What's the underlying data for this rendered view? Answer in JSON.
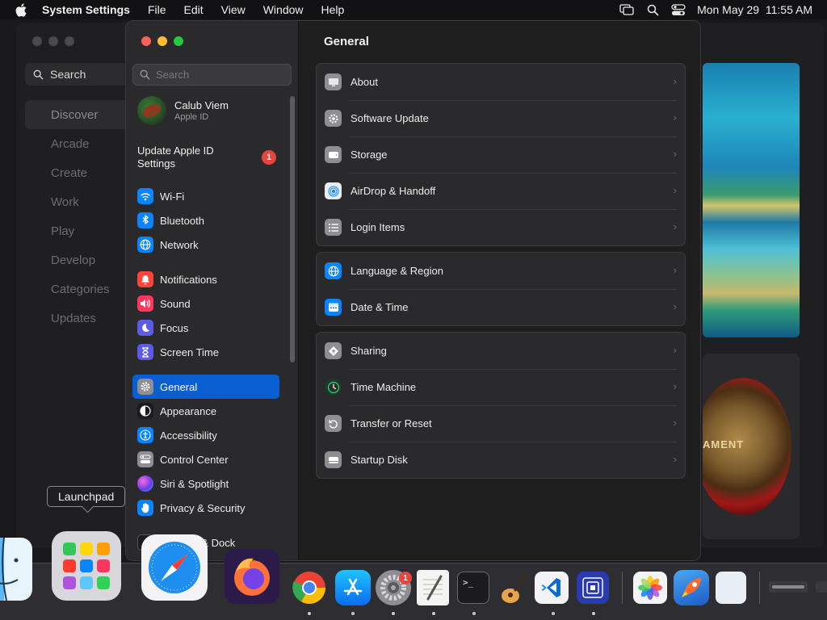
{
  "menubar": {
    "app_name": "System Settings",
    "items": [
      "File",
      "Edit",
      "View",
      "Window",
      "Help"
    ],
    "clock": "Mon May 29  11:55 AM"
  },
  "appstore": {
    "search_placeholder": "Search",
    "nav": [
      "Discover",
      "Arcade",
      "Create",
      "Work",
      "Play",
      "Develop",
      "Categories",
      "Updates"
    ],
    "medal_text": "AMENT"
  },
  "settings": {
    "search_placeholder": "Search",
    "profile": {
      "name": "Calub Viem",
      "subtitle": "Apple ID"
    },
    "update": {
      "label": "Update Apple ID Settings",
      "badge": "1"
    },
    "sidebar_groups": [
      [
        {
          "label": "Wi-Fi",
          "icon": "wifi-icon",
          "color": "#0a84ff"
        },
        {
          "label": "Bluetooth",
          "icon": "bluetooth-icon",
          "color": "#0a84ff"
        },
        {
          "label": "Network",
          "icon": "globe-icon",
          "color": "#0a84ff"
        }
      ],
      [
        {
          "label": "Notifications",
          "icon": "bell-icon",
          "color": "#ff453a"
        },
        {
          "label": "Sound",
          "icon": "speaker-icon",
          "color": "#ff375f"
        },
        {
          "label": "Focus",
          "icon": "moon-icon",
          "color": "#5e5ce6"
        },
        {
          "label": "Screen Time",
          "icon": "hourglass-icon",
          "color": "#5e5ce6"
        }
      ],
      [
        {
          "label": "General",
          "icon": "gear-icon",
          "color": "#8e8e93",
          "selected": true
        },
        {
          "label": "Appearance",
          "icon": "appearance-icon",
          "color": "#1c1c1e"
        },
        {
          "label": "Accessibility",
          "icon": "accessibility-icon",
          "color": "#0a84ff"
        },
        {
          "label": "Control Center",
          "icon": "control-center-icon",
          "color": "#8e8e93"
        },
        {
          "label": "Siri & Spotlight",
          "icon": "siri-icon",
          "color": "#bf5af2"
        },
        {
          "label": "Privacy & Security",
          "icon": "hand-icon",
          "color": "#0a84ff"
        },
        {
          "label": "Desktop & Dock",
          "icon": "dock-icon",
          "color": "#1c1c1e"
        }
      ]
    ],
    "title": "General",
    "groups": [
      [
        {
          "label": "About",
          "icon": "display-icon"
        },
        {
          "label": "Software Update",
          "icon": "gear-badge-icon"
        },
        {
          "label": "Storage",
          "icon": "storage-icon"
        },
        {
          "label": "AirDrop & Handoff",
          "icon": "airdrop-icon"
        },
        {
          "label": "Login Items",
          "icon": "list-icon"
        }
      ],
      [
        {
          "label": "Language & Region",
          "icon": "globe-icon"
        },
        {
          "label": "Date & Time",
          "icon": "calendar-icon"
        }
      ],
      [
        {
          "label": "Sharing",
          "icon": "sharing-icon"
        },
        {
          "label": "Time Machine",
          "icon": "clock-icon"
        },
        {
          "label": "Transfer or Reset",
          "icon": "reset-icon"
        },
        {
          "label": "Startup Disk",
          "icon": "disk-icon"
        }
      ]
    ]
  },
  "tooltip": "Launchpad",
  "dock": {
    "items": [
      {
        "name": "finder",
        "running": false
      },
      {
        "name": "launchpad",
        "running": false
      },
      {
        "name": "safari",
        "running": false
      },
      {
        "name": "firefox",
        "running": false
      },
      {
        "name": "chrome",
        "running": true
      },
      {
        "name": "app-store",
        "running": true
      },
      {
        "name": "system-settings",
        "running": true,
        "badge": "1"
      },
      {
        "name": "textedit",
        "running": true
      },
      {
        "name": "terminal",
        "running": true
      },
      {
        "name": "garageband",
        "running": false
      },
      {
        "name": "vscode",
        "running": true
      },
      {
        "name": "simulator",
        "running": true
      },
      {
        "name": "photos",
        "running": false
      },
      {
        "name": "instruments",
        "running": false
      },
      {
        "name": "preview",
        "running": false
      },
      {
        "name": "minimized-window",
        "running": false
      }
    ]
  }
}
